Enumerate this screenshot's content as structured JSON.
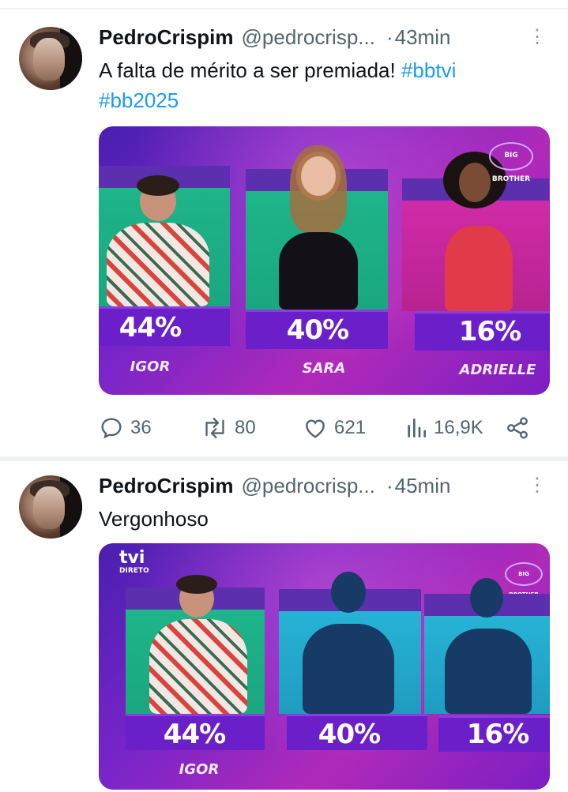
{
  "tweets": [
    {
      "name": "PedroCrispim",
      "handle": "@pedrocrisp...",
      "dot": "·",
      "time": "43min",
      "more": "⋮",
      "text_plain": "A falta de mérito a ser premiada! ",
      "hashtags": [
        "#bbtvi",
        "#bb2025"
      ],
      "media": {
        "badge": "BIG BROTHER",
        "candidates": [
          {
            "percent": "44%",
            "name": "IGOR"
          },
          {
            "percent": "40%",
            "name": "SARA"
          },
          {
            "percent": "16%",
            "name": "ADRIELLE"
          }
        ]
      },
      "actions": {
        "replies": "36",
        "reposts": "80",
        "likes": "621",
        "views": "16,9K"
      }
    },
    {
      "name": "PedroCrispim",
      "handle": "@pedrocrisp...",
      "dot": "·",
      "time": "45min",
      "more": "⋮",
      "text_plain": "Vergonhoso",
      "media": {
        "channel_logo": "tvi",
        "channel_sub": "DIRETO",
        "badge": "BIG BROTHER",
        "candidates": [
          {
            "percent": "44%",
            "name": "IGOR"
          },
          {
            "percent": "40%",
            "name": ""
          },
          {
            "percent": "16%",
            "name": ""
          }
        ]
      }
    }
  ],
  "colors": {
    "link": "#1d9bf0",
    "secondary_text": "#536471",
    "media_purple": "#6a1fc9"
  }
}
